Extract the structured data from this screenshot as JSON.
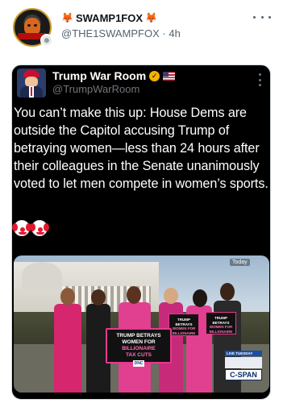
{
  "post": {
    "author": {
      "display_name": "SWAMP1FOX",
      "name_prefix_emoji": "🦊",
      "name_suffix_emoji": "🦊",
      "handle": "@THE1SWAMPFOX",
      "separator": "·",
      "time": "4h"
    },
    "more_icon": "more-horizontal-icon",
    "media": {
      "author": {
        "display_name": "Trump War Room",
        "handle": "@TrumpWarRoom",
        "badges": [
          "verified-gold-icon",
          "us-flag-icon"
        ]
      },
      "text": "You can’t make this up: House Dems are outside the Capitol accusing Trump of betraying women—less than 24 hours after their colleagues in the Senate unanimously voted to let men compete in women’s sports.",
      "emoji_icons": [
        "clown-face-icon",
        "clown-face-icon"
      ],
      "photo": {
        "overlay_label": "Today",
        "podium_sign": {
          "line1": "TRUMP BETRAYS",
          "line2": "WOMEN FOR",
          "line3": "BILLIONAIRE",
          "line4": "TAX CUTS",
          "tag": "DNC"
        },
        "held_sign_left": {
          "line1": "TRUMP BETRAYS",
          "line2": "WOMEN FOR",
          "line3": "BILLIONAIRE"
        },
        "held_sign_right": {
          "line1": "TRUMP BETRAYS",
          "line2": "WOMEN FOR",
          "line3": "BILLIONAIRE"
        },
        "network_live": "LIVE  TUESDAY",
        "network_logo": "C-SPAN"
      }
    }
  },
  "colors": {
    "handle_gray": "#536471",
    "sign_pink": "#e6398f",
    "media_bg": "#000000"
  }
}
